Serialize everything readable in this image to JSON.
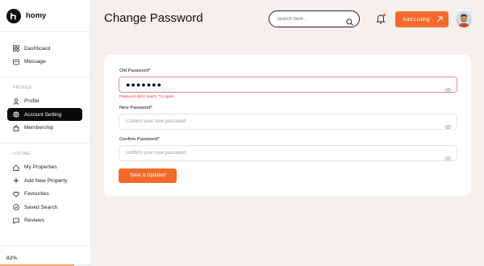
{
  "brand": {
    "name": "homy"
  },
  "sidebar": {
    "main": [
      {
        "label": "Dashboard",
        "icon": "grid-icon"
      },
      {
        "label": "Message",
        "icon": "message-icon"
      }
    ],
    "profile_title": "PROFILE",
    "profile": [
      {
        "label": "Profile",
        "icon": "user-icon"
      },
      {
        "label": "Account Setting",
        "icon": "gear-icon",
        "active": true
      },
      {
        "label": "Membership",
        "icon": "membership-icon"
      }
    ],
    "listing_title": "LISTING",
    "listing": [
      {
        "label": "My Properties",
        "icon": "home-icon"
      },
      {
        "label": "Add New Property",
        "icon": "plus-icon"
      },
      {
        "label": "Favourites",
        "icon": "heart-icon"
      },
      {
        "label": "Saved Search",
        "icon": "check-circle-icon"
      },
      {
        "label": "Reviews",
        "icon": "review-icon"
      }
    ],
    "progress": {
      "label": "82%",
      "value": 0.82
    }
  },
  "header": {
    "title": "Change Password",
    "search_placeholder": "Search here..",
    "add_listing_label": "Add Listing"
  },
  "form": {
    "old_password": {
      "label": "Old Password*",
      "value": "●●●●●●●",
      "error": "Password didn't match, Try again"
    },
    "new_password": {
      "label": "New Password*",
      "placeholder": "Confirm your new password"
    },
    "confirm_password": {
      "label": "Confirm Password*",
      "placeholder": "Confirm your new password"
    },
    "submit_label": "Save & Updated"
  },
  "colors": {
    "accent": "#f26b2d",
    "active_nav": "#0b0b0b",
    "error": "#e53935",
    "background": "#f5f0eb"
  }
}
